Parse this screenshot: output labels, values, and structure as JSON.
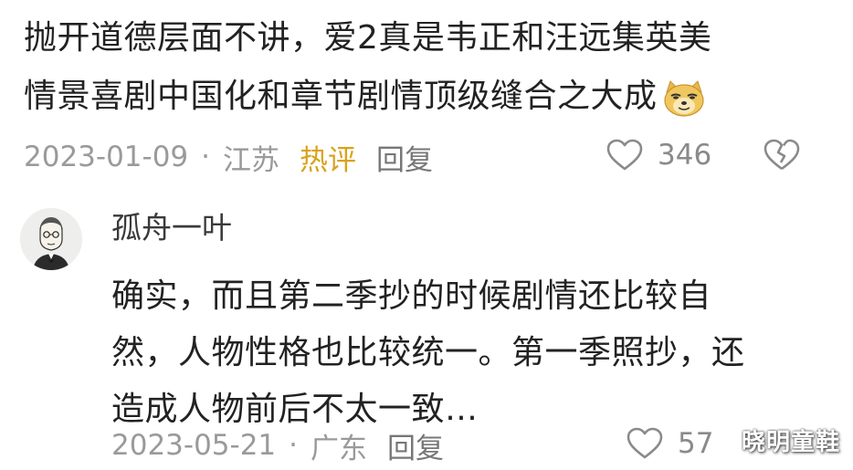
{
  "comment": {
    "text_line1": "抛开道德层面不讲，爱2真是韦正和汪远集英美",
    "text_line2": "情景喜剧中国化和章节剧情顶级缝合之大成",
    "emoji": "doge-icon",
    "date": "2023-01-09",
    "separator": "·",
    "location": "江苏",
    "hot_label": "热评",
    "reply_label": "回复",
    "like_count": "346"
  },
  "reply": {
    "username": "孤舟一叶",
    "text_line1": "确实，而且第二季抄的时候剧情还比较自",
    "text_line2": "然，人物性格也比较统一。第一季照抄，还",
    "text_line3": "造成人物前后不太一致…",
    "date": "2023-05-21",
    "separator": "·",
    "location": "广东",
    "reply_label": "回复",
    "like_count": "57"
  },
  "watermark": "晓明童鞋",
  "colors": {
    "hot": "#d9a21b",
    "meta": "#9a9a9a",
    "text": "#222222"
  }
}
